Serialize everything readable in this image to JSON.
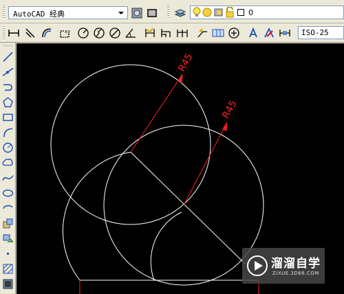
{
  "toolbar_top": {
    "workspace": "AutoCAD 经典",
    "layer_name": "0",
    "icons": [
      "workspace-settings-icon",
      "my-workspace-icon",
      "layer-manager-icon",
      "light-bulb-icon",
      "sun-icon",
      "freeze-viewport-icon",
      "lock-icon",
      "color-square-icon"
    ]
  },
  "toolbar_dim": {
    "icons": [
      "linear-dimension-icon",
      "aligned-dimension-icon",
      "arc-length-icon",
      "ordinate-icon",
      "radius-icon",
      "jogged-icon",
      "diameter-icon",
      "angular-icon",
      "quick-dimension-icon",
      "baseline-icon",
      "continue-icon",
      "quick-leader-icon",
      "tolerance-icon",
      "center-mark-icon",
      "dimension-edit-icon",
      "dimension-text-edit-icon",
      "dimension-update-icon"
    ],
    "dim_style": "ISO-25"
  },
  "draw_toolbar": {
    "icons": [
      "line-icon",
      "construction-line-icon",
      "polyline-icon",
      "polygon-icon",
      "rectangle-icon",
      "arc-icon",
      "circle-icon",
      "revision-cloud-icon",
      "spline-icon",
      "ellipse-icon",
      "ellipse-arc-icon",
      "insert-block-icon",
      "make-block-icon",
      "point-icon",
      "hatch-icon",
      "gradient-icon"
    ]
  },
  "drawing": {
    "dimension_labels": [
      "R45",
      "R45"
    ],
    "line_color": "#ffffff",
    "dimension_color": "#ff0000",
    "background": "#000000"
  },
  "watermark": {
    "title": "溜溜自学",
    "url": "ZIXUE.3D66.COM"
  }
}
